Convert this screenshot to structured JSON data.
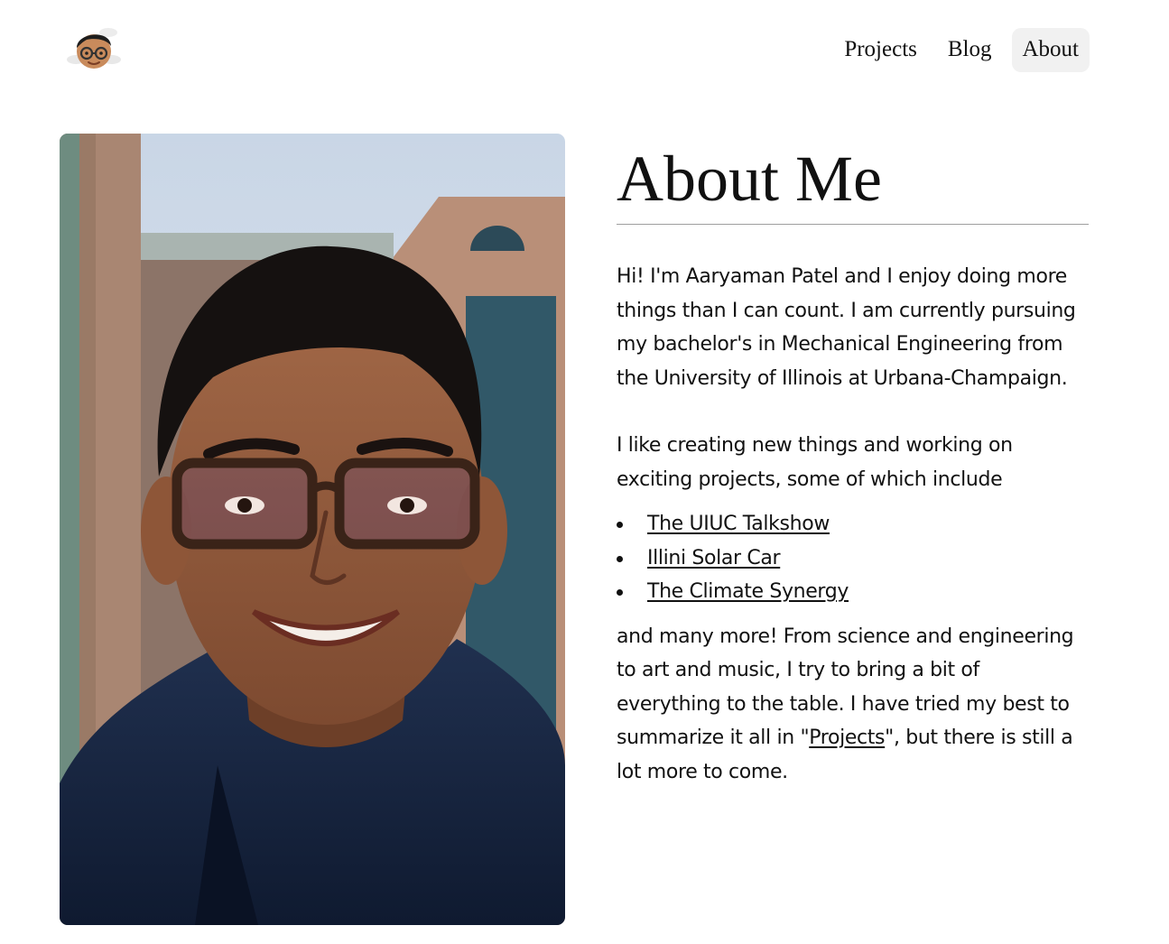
{
  "header": {
    "logo": {
      "icon": "memoji-avatar-icon"
    },
    "nav": [
      {
        "label": "Projects",
        "active": false
      },
      {
        "label": "Blog",
        "active": false
      },
      {
        "label": "About",
        "active": true
      }
    ]
  },
  "main": {
    "photo": {
      "description": "portrait-photo"
    },
    "title": "About Me",
    "intro": "Hi! I'm Aaryaman Patel and I enjoy doing more things than I can count. I am currently pursuing my bachelor's in Mechanical Engineering from the University of Illinois at Urbana-Champaign.",
    "projects_intro": "I like creating new things and working on exciting projects, some of which include",
    "projects": [
      {
        "label": "The UIUC Talkshow"
      },
      {
        "label": "Illini Solar Car"
      },
      {
        "label": "The Climate Synergy"
      }
    ],
    "outro": {
      "before": "and many more! From science and engineering to art and music, I try to bring a bit of everything to the table. I have tried my best to summarize it all in \"",
      "link": "Projects",
      "after": "\", but there is still a lot more to come."
    }
  },
  "colors": {
    "text": "#111111",
    "nav_active_bg": "#f1f1f1",
    "rule": "#9e9e9e",
    "background": "#ffffff"
  }
}
